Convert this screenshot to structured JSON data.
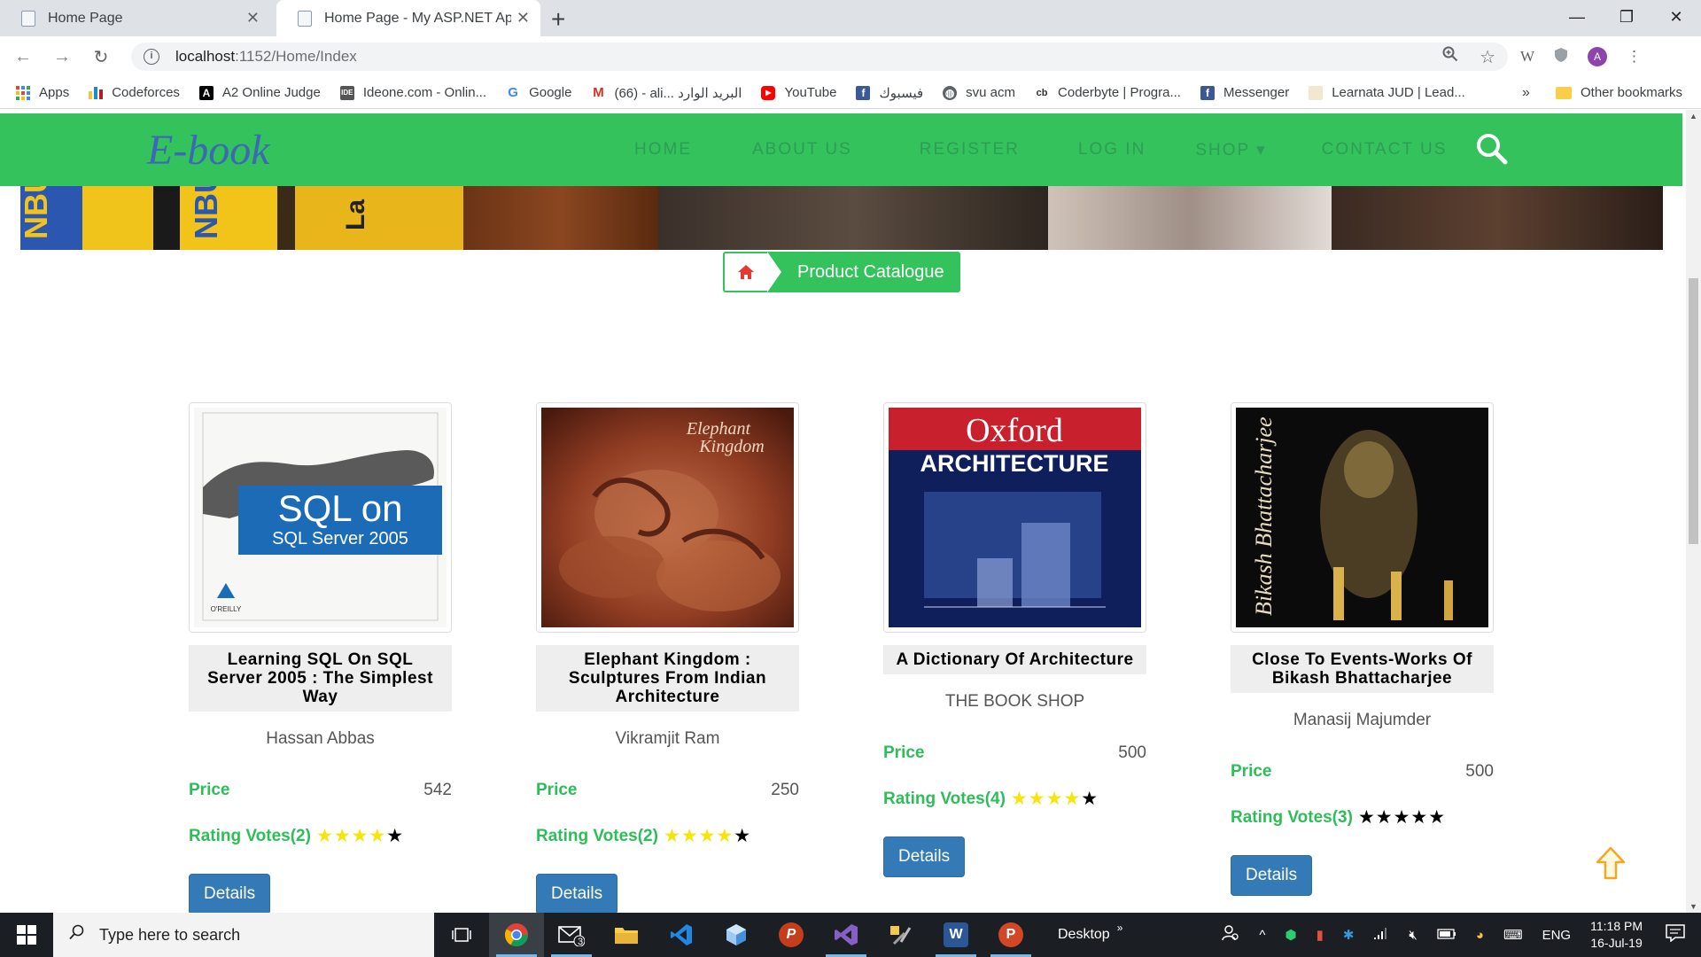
{
  "browser": {
    "tabs": [
      {
        "title": "Home Page",
        "active": false
      },
      {
        "title": "Home Page - My ASP.NET Applic",
        "active": true
      }
    ],
    "new_tab_label": "+",
    "window_controls": {
      "minimize": "—",
      "maximize": "❐",
      "close": "✕"
    },
    "url_host": "localhost",
    "url_path": ":1152/Home/Index",
    "bookmarks": [
      {
        "label": "Apps",
        "icon": "apps-grid-icon",
        "color": "#4285f4"
      },
      {
        "label": "Codeforces",
        "icon": "codeforces-icon",
        "color": "#1f8acb"
      },
      {
        "label": "A2 Online Judge",
        "icon": "a2-icon",
        "color": "#000000"
      },
      {
        "label": "Ideone.com - Onlin...",
        "icon": "ideone-icon",
        "color": "#444444"
      },
      {
        "label": "Google",
        "icon": "google-icon",
        "color": "#4285f4"
      },
      {
        "label": "(66) - ali... البريد الوارد",
        "icon": "gmail-icon",
        "color": "#d93025"
      },
      {
        "label": "YouTube",
        "icon": "youtube-icon",
        "color": "#ff0000"
      },
      {
        "label": "فيسبوك",
        "icon": "facebook-icon",
        "color": "#3b5998"
      },
      {
        "label": "svu acm",
        "icon": "globe-icon",
        "color": "#5f6368"
      },
      {
        "label": "Coderbyte | Progra...",
        "icon": "coderbyte-icon",
        "color": "#333333"
      },
      {
        "label": "Messenger",
        "icon": "facebook-icon",
        "color": "#3b5998"
      },
      {
        "label": "Learnata JUD | Lead...",
        "icon": "learnata-icon",
        "color": "#e0c080"
      }
    ],
    "bookmarks_overflow": "»",
    "other_bookmarks": "Other bookmarks"
  },
  "site": {
    "brand": "E-book",
    "nav": [
      "HOME",
      "ABOUT US",
      "REGISTER",
      "LOG IN",
      "SHOP ▾",
      "CONTACT US"
    ],
    "breadcrumb": "Product Catalogue"
  },
  "products": [
    {
      "title": "Learning SQL On SQL Server 2005 : The Simplest Way",
      "author": "Hassan Abbas",
      "price_label": "Price",
      "price": "542",
      "rating_label": "Rating Votes(2)",
      "rating": 4,
      "stars_total": 5,
      "details": "Details",
      "cover": "sql-server-book-cover"
    },
    {
      "title": "Elephant Kingdom : Sculptures From Indian Architecture",
      "author": "Vikramjit Ram",
      "price_label": "Price",
      "price": "250",
      "rating_label": "Rating Votes(2)",
      "rating": 4,
      "stars_total": 5,
      "details": "Details",
      "cover": "elephant-kingdom-book-cover"
    },
    {
      "title": "A Dictionary Of Architecture",
      "author": "THE BOOK SHOP",
      "price_label": "Price",
      "price": "500",
      "rating_label": "Rating Votes(4)",
      "rating": 4,
      "stars_total": 5,
      "details": "Details",
      "cover": "oxford-architecture-book-cover"
    },
    {
      "title": "Close To Events-Works Of Bikash Bhattacharjee",
      "author": "Manasij Majumder",
      "price_label": "Price",
      "price": "500",
      "rating_label": "Rating Votes(3)",
      "rating": 0,
      "stars_total": 5,
      "details": "Details",
      "cover": "bikash-bhattacharjee-book-cover"
    }
  ],
  "covers": {
    "sql": {
      "line1": "SQL on",
      "line2": "SQL Server 2005"
    },
    "elephant": {
      "line1": "Elephant",
      "line2": "Kingdom"
    },
    "oxford": {
      "line1": "Oxford",
      "line2": "ARCHITECTURE"
    },
    "bikash": {
      "line1": "Bikash Bhattacharjee"
    }
  },
  "colors": {
    "nav_green": "#33c25b",
    "label_green": "#2ebd59",
    "button_blue": "#337ab7",
    "star_filled": "#f5e50a",
    "star_empty": "#000000"
  },
  "taskbar": {
    "search_placeholder": "Type here to search",
    "desktop_label": "Desktop",
    "language": "ENG",
    "time": "11:18 PM",
    "date": "16-Jul-19",
    "mail_badge": "3"
  }
}
